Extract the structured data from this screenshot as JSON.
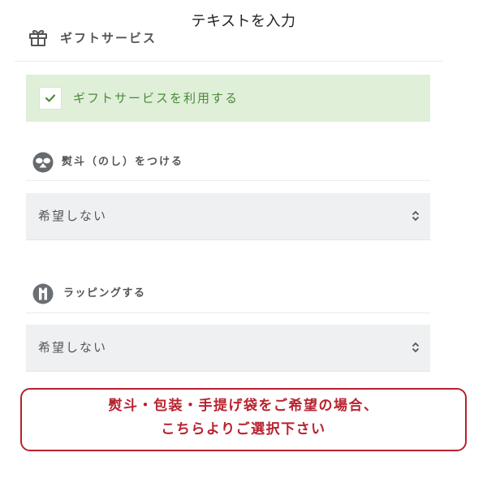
{
  "top_text": "テキストを入力",
  "gift_service": {
    "icon": "gift-icon",
    "title": "ギフトサービス",
    "checkbox": {
      "checked": true,
      "icon": "check-icon",
      "label": "ギフトサービスを利用する"
    }
  },
  "noshi": {
    "icon": "noshi-icon",
    "label": "熨斗（のし）をつける",
    "select_value": "希望しない",
    "select_icon": "up-down-arrows-icon"
  },
  "wrapping": {
    "icon": "wrapping-icon",
    "label": "ラッピングする",
    "select_value": "希望しない",
    "select_icon": "up-down-arrows-icon"
  },
  "notice_button": {
    "line1": "熨斗・包装・手提げ袋をご希望の場合、",
    "line2": "こちらよりご選択下さい"
  },
  "colors": {
    "green_bg": "#dfefd8",
    "green_text": "#4b8a3b",
    "red": "#b8222f",
    "select_bg": "#eef0f2",
    "text": "#555555"
  }
}
